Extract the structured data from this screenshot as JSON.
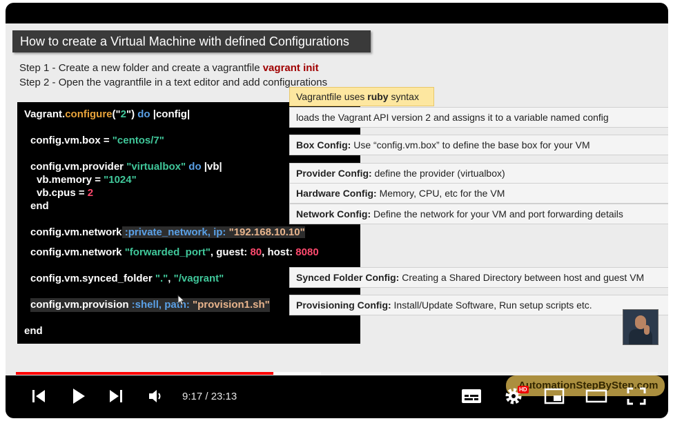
{
  "slide": {
    "title": "How to create a Virtual Machine with defined Configurations",
    "step1_text": "Step 1 - Create a new folder and create a vagrantfile ",
    "step1_cmd": "vagrant init",
    "step2_text": "Step 2 - Open the vagrantfile in a text editor and add configurations"
  },
  "code": {
    "l1": [
      "Vagrant.",
      "configure",
      "(\"",
      "2",
      "\") ",
      "do",
      " |config|"
    ],
    "l2": [
      "config.vm.box = ",
      "\"centos/7\""
    ],
    "l3": [
      "config.vm.provider ",
      "\"virtualbox\"",
      " do",
      " |vb|"
    ],
    "l4": [
      "vb.memory = ",
      "\"1024\""
    ],
    "l5": [
      "vb.cpus = ",
      "2"
    ],
    "l6": "end",
    "l7": [
      "config.vm.network",
      " :private_network,",
      " ip: ",
      "\"192.168.10.10\""
    ],
    "l8": [
      "config.vm.network ",
      "\"forwarded_port\"",
      ", guest: ",
      "80",
      ", host: ",
      "8080"
    ],
    "l9": [
      "config.vm.synced_folder ",
      "\".\"",
      ", ",
      "\"/vagrant\""
    ],
    "l10": [
      "config.vm.provision",
      " :shell,",
      " path: ",
      "\"provision1.sh\""
    ],
    "l11": "end"
  },
  "annotations": {
    "ruby": {
      "pre": "Vagrantfile uses ",
      "bold": "ruby",
      "post": " syntax"
    },
    "api": {
      "bold": "",
      "text": "loads the Vagrant API version 2 and assigns it to a variable named config"
    },
    "box": {
      "bold": "Box Config:",
      "text": " Use “config.vm.box” to define the base box for your VM"
    },
    "provider": {
      "bold": "Provider Config:",
      "text": " define the provider (virtualbox)"
    },
    "hardware": {
      "bold": "Hardware Config:",
      "text": " Memory, CPU, etc for the VM"
    },
    "network": {
      "bold": "Network Config:",
      "text": " Define the network for your VM and port forwarding details"
    },
    "synced": {
      "bold": "Synced Folder Config:",
      "text": " Creating a Shared Directory between host and guest VM"
    },
    "provision": {
      "bold": "Provisioning Config:",
      "text": " Install/Update Software, Run setup scripts etc."
    }
  },
  "player": {
    "time": "9:17 / 23:13",
    "watermark": "AutomationStepByStep.com",
    "hd_badge": "HD",
    "progress_played_fraction": 0.401,
    "progress_buffered_fraction": 0.475,
    "icons": [
      "skip-previous-icon",
      "play-icon",
      "skip-next-icon",
      "volume-icon",
      "subtitles-icon",
      "settings-icon",
      "miniplayer-icon",
      "theater-mode-icon",
      "fullscreen-icon"
    ]
  },
  "colors": {
    "progress": "#ff0000",
    "step_highlight": "#a00000",
    "ruby_note_bg": "#fde7a0"
  }
}
